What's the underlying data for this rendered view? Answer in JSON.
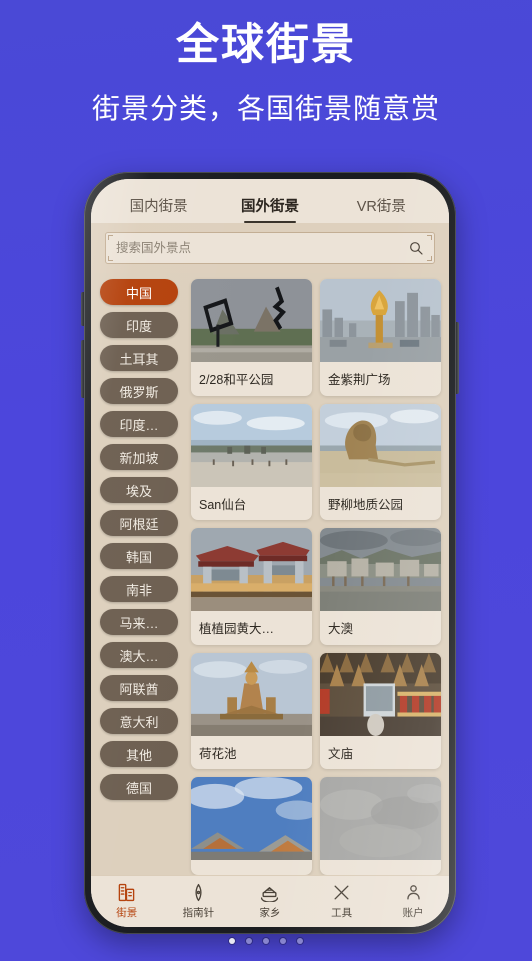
{
  "promo": {
    "title": "全球街景",
    "subtitle": "街景分类，各国街景随意赏"
  },
  "colors": {
    "background": "#4a49d6",
    "accent": "#b5420d",
    "app_background": "#ece3d7",
    "panel": "#ddd0bd",
    "chip_inactive": "#6e6052"
  },
  "app": {
    "tabs": [
      {
        "label": "国内街景",
        "active": false
      },
      {
        "label": "国外街景",
        "active": true
      },
      {
        "label": "VR街景",
        "active": false
      }
    ],
    "search": {
      "placeholder": "搜索国外景点",
      "value": "",
      "icon": "search-icon"
    },
    "countries": [
      {
        "label": "中国",
        "active": true
      },
      {
        "label": "印度",
        "active": false
      },
      {
        "label": "土耳其",
        "active": false
      },
      {
        "label": "俄罗斯",
        "active": false
      },
      {
        "label": "印度…",
        "active": false
      },
      {
        "label": "新加坡",
        "active": false
      },
      {
        "label": "埃及",
        "active": false
      },
      {
        "label": "阿根廷",
        "active": false
      },
      {
        "label": "韩国",
        "active": false
      },
      {
        "label": "南非",
        "active": false
      },
      {
        "label": "马来…",
        "active": false
      },
      {
        "label": "澳大…",
        "active": false
      },
      {
        "label": "阿联酋",
        "active": false
      },
      {
        "label": "意大利",
        "active": false
      },
      {
        "label": "其他",
        "active": false
      },
      {
        "label": "德国",
        "active": false
      }
    ],
    "spots": [
      {
        "label": "2/28和平公园",
        "scene": "sculpture-park"
      },
      {
        "label": "金紫荆广场",
        "scene": "golden-bauhinia"
      },
      {
        "label": "San仙台",
        "scene": "beach"
      },
      {
        "label": "野柳地质公园",
        "scene": "rock-coast"
      },
      {
        "label": "植植园黄大…",
        "scene": "temple-gate"
      },
      {
        "label": "大澳",
        "scene": "stilt-village"
      },
      {
        "label": "荷花池",
        "scene": "statue-shrine"
      },
      {
        "label": "文庙",
        "scene": "temple-interior"
      },
      {
        "label": "",
        "scene": "roof-sky"
      },
      {
        "label": "",
        "scene": "overcast"
      }
    ],
    "bottom_nav": [
      {
        "label": "街景",
        "icon": "building-icon",
        "active": true
      },
      {
        "label": "指南针",
        "icon": "compass-icon",
        "active": false
      },
      {
        "label": "家乡",
        "icon": "hometown-icon",
        "active": false
      },
      {
        "label": "工具",
        "icon": "tools-icon",
        "active": false
      },
      {
        "label": "账户",
        "icon": "person-icon",
        "active": false
      }
    ]
  },
  "carousel": {
    "total_pages": 5,
    "current_page": 1
  }
}
